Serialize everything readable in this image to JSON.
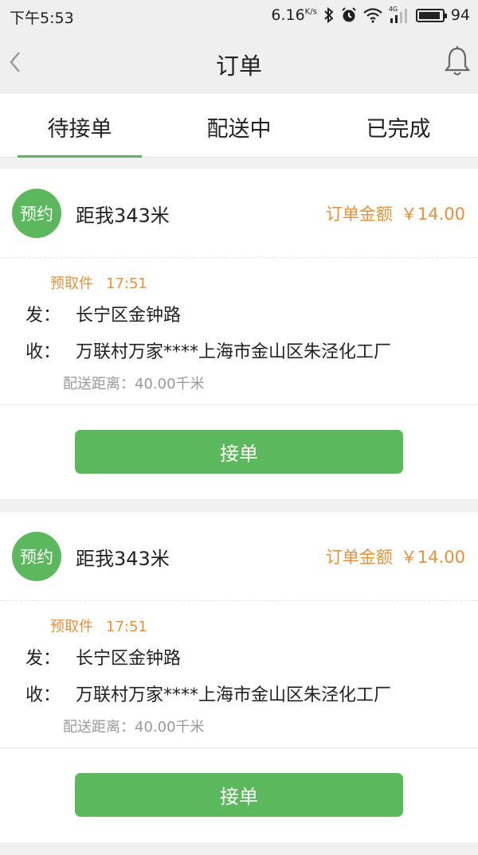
{
  "status_bar": {
    "time": "下午5:53",
    "speed": "6.16",
    "speed_unit": "K/s",
    "network_label": "4G",
    "battery": "94"
  },
  "nav": {
    "title": "订单"
  },
  "tabs": [
    {
      "label": "待接单",
      "active": true
    },
    {
      "label": "配送中",
      "active": false
    },
    {
      "label": "已完成",
      "active": false
    }
  ],
  "orders": [
    {
      "badge": "预约",
      "distance": "距我343米",
      "amount_label": "订单金额",
      "amount": "￥14.00",
      "pickup_label": "预取件",
      "pickup_time": "17:51",
      "from_label": "发：",
      "from": "长宁区金钟路",
      "to_label": "收：",
      "to": "万联村万家****上海市金山区朱泾化工厂",
      "ship_distance": "配送距离：40.00千米",
      "accept_label": "接单"
    },
    {
      "badge": "预约",
      "distance": "距我343米",
      "amount_label": "订单金额",
      "amount": "￥14.00",
      "pickup_label": "预取件",
      "pickup_time": "17:51",
      "from_label": "发：",
      "from": "长宁区金钟路",
      "to_label": "收：",
      "to": "万联村万家****上海市金山区朱泾化工厂",
      "ship_distance": "配送距离：40.00千米",
      "accept_label": "接单"
    }
  ],
  "colors": {
    "accent_green": "#5cb85c",
    "accent_orange": "#e6913a",
    "muted_text": "#999999"
  },
  "icons": [
    "back-arrow-icon",
    "bell-icon",
    "bluetooth-icon",
    "alarm-icon",
    "wifi-icon",
    "signal-icon",
    "battery-icon"
  ]
}
